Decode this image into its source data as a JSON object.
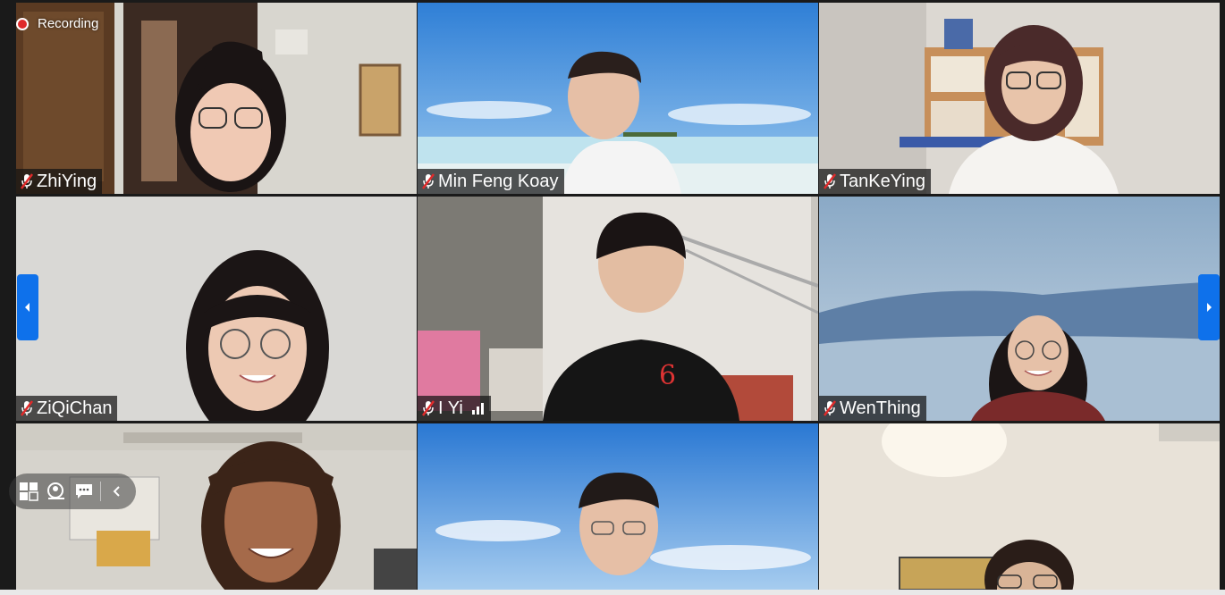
{
  "recording": {
    "label": "Recording"
  },
  "participants": [
    {
      "name": "ZhiYing",
      "muted": true
    },
    {
      "name": "Min Feng Koay",
      "muted": true
    },
    {
      "name": "TanKeYing",
      "muted": true
    },
    {
      "name": "ZiQiChan",
      "muted": true
    },
    {
      "name": "I Yi",
      "muted": true,
      "signal": true
    },
    {
      "name": "WenThing",
      "muted": true
    },
    {
      "name": "",
      "muted": false
    },
    {
      "name": "",
      "muted": false
    },
    {
      "name": "",
      "muted": false
    }
  ],
  "colors": {
    "accent": "#0e71eb",
    "recording_dot": "#e02a2a",
    "muted_mic": "#e02a2a"
  },
  "icons": {
    "recording": "recording-dot-icon",
    "prev": "chevron-left-icon",
    "next": "chevron-right-icon",
    "layout": "grid-layout-icon",
    "hide_self": "hide-self-view-icon",
    "chat": "chat-icon",
    "collapse": "chevron-left-icon"
  }
}
